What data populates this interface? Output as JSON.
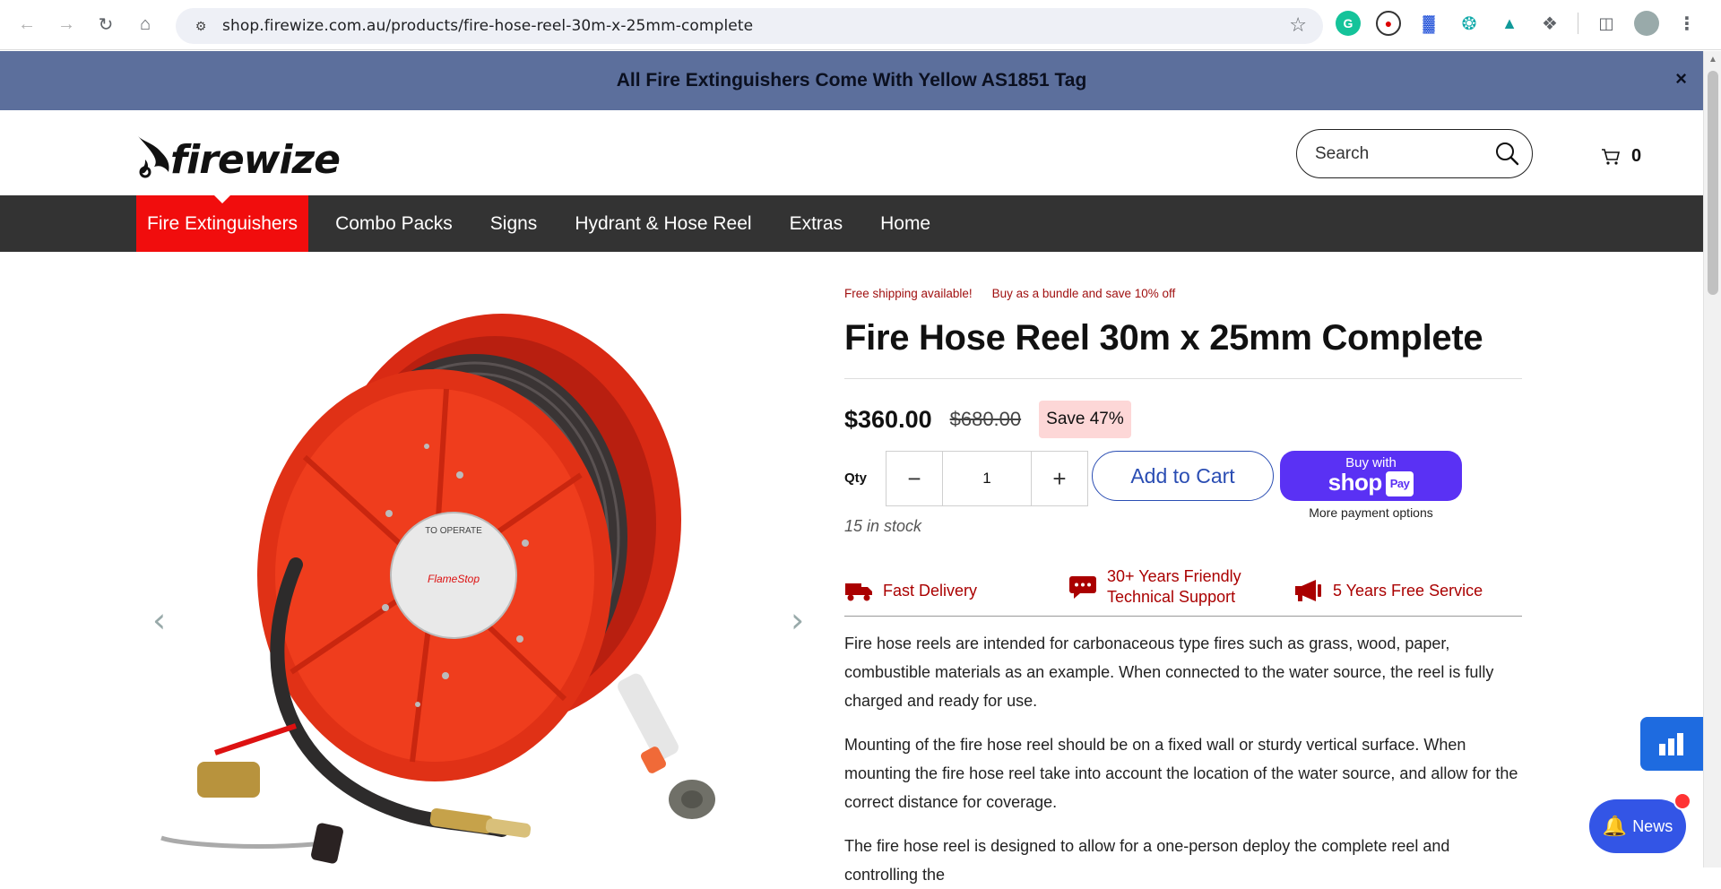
{
  "browser": {
    "url": "shop.firewize.com.au/products/fire-hose-reel-30m-x-25mm-complete"
  },
  "announcement": {
    "text": "All Fire Extinguishers Come With Yellow AS1851 Tag",
    "close": "×"
  },
  "header": {
    "logo_text": "firewize",
    "search_placeholder": "Search",
    "cart_count": "0"
  },
  "nav": {
    "items": [
      "Fire Extinguishers",
      "Combo Packs",
      "Signs",
      "Hydrant & Hose Reel",
      "Extras",
      "Home"
    ],
    "active_index": 0
  },
  "product": {
    "promo_1": "Free shipping available!",
    "promo_2": "Buy as a bundle and save 10% off",
    "title": "Fire Hose Reel 30m x 25mm Complete",
    "price": "$360.00",
    "compare_price": "$680.00",
    "save_badge": "Save 47%",
    "qty_label": "Qty",
    "qty_value": "1",
    "add_to_cart": "Add to Cart",
    "shop_pay_small": "Buy with",
    "shop_pay_big": "shop",
    "shop_pay_tag": "Pay",
    "more_payment": "More payment options",
    "stock": "15 in stock",
    "features": [
      {
        "text": "Fast Delivery",
        "icon": "truck-icon"
      },
      {
        "text": "30+ Years Friendly",
        "text2": "Technical Support",
        "icon": "chat-icon"
      },
      {
        "text": "5 Years Free Service",
        "icon": "megaphone-icon"
      }
    ],
    "description": [
      "Fire hose reels are intended for carbonaceous type fires such as grass, wood, paper, combustible materials as an example. When connected to the water source, the reel is fully charged and ready for use.",
      "Mounting of the fire hose reel should be on a fixed wall or sturdy vertical surface. When mounting the fire hose reel take into account the location of the water source, and allow for the correct distance for coverage.",
      "The fire hose reel is designed to allow for a one-person deploy the complete reel and controlling the"
    ],
    "image_label_top": "TO OPERATE",
    "image_brand": "FlameStop"
  },
  "widgets": {
    "news_label": "News"
  },
  "colors": {
    "announcement_bg": "#5c6f9c",
    "nav_bg": "#333333",
    "nav_active": "#f10d0d",
    "accent_red": "#a00000",
    "shop_pay": "#5a31f4"
  }
}
